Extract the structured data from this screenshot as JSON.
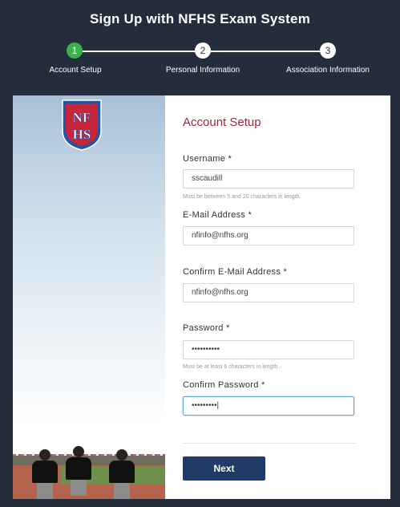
{
  "header": {
    "title": "Sign Up with NFHS Exam System"
  },
  "steps": [
    {
      "number": "1",
      "label": "Account Setup",
      "active": true
    },
    {
      "number": "2",
      "label": "Personal Information",
      "active": false
    },
    {
      "number": "3",
      "label": "Association Information",
      "active": false
    }
  ],
  "colors": {
    "accent_green": "#3cb34a",
    "title_red": "#a3263a",
    "button_navy": "#1f3b66"
  },
  "logo": {
    "text": "NFHS",
    "icon": "nfhs-shield-logo"
  },
  "form": {
    "title": "Account Setup",
    "username": {
      "label": "Username",
      "required_mark": "*",
      "value": "sscaudill",
      "hint": "Must be between 5 and 20 characters in length."
    },
    "email": {
      "label": "E-Mail Address",
      "required_mark": "*",
      "value": "nfinfo@nfhs.org"
    },
    "confirm_email": {
      "label": "Confirm E-Mail Address",
      "required_mark": "*",
      "value": "nfinfo@nfhs.org"
    },
    "password": {
      "label": "Password",
      "required_mark": "*",
      "value": "••••••••••",
      "hint": "Must be at least 6 characters in length."
    },
    "confirm_password": {
      "label": "Confirm Password",
      "required_mark": "*",
      "value": "•••••••••|"
    },
    "next_label": "Next"
  }
}
